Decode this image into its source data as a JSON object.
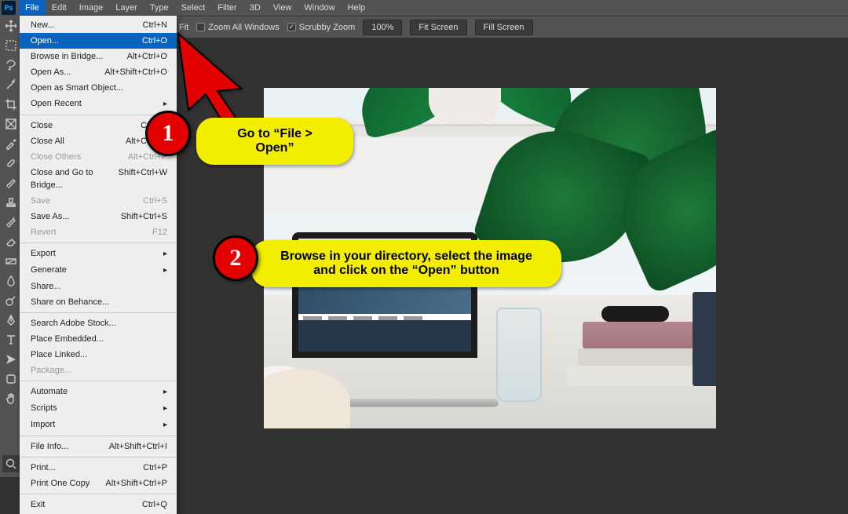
{
  "menubar": {
    "items": [
      "File",
      "Edit",
      "Image",
      "Layer",
      "Type",
      "Select",
      "Filter",
      "3D",
      "View",
      "Window",
      "Help"
    ],
    "active_index": 0
  },
  "optbar": {
    "fit_label": "Fit",
    "zoom_all_label": "Zoom All Windows",
    "scrubby_label": "Scrubby Zoom",
    "scrubby_checked": "✓",
    "zoom_value": "100%",
    "fit_screen": "Fit Screen",
    "fill_screen": "Fill Screen"
  },
  "file_menu": [
    {
      "label": "New...",
      "shortcut": "Ctrl+N"
    },
    {
      "label": "Open...",
      "shortcut": "Ctrl+O",
      "highlight": true
    },
    {
      "label": "Browse in Bridge...",
      "shortcut": "Alt+Ctrl+O"
    },
    {
      "label": "Open As...",
      "shortcut": "Alt+Shift+Ctrl+O"
    },
    {
      "label": "Open as Smart Object..."
    },
    {
      "label": "Open Recent",
      "sub": true
    },
    {
      "sep": true
    },
    {
      "label": "Close",
      "shortcut": "Ctrl+W"
    },
    {
      "label": "Close All",
      "shortcut": "Alt+Ctrl+W"
    },
    {
      "label": "Close Others",
      "shortcut": "Alt+Ctrl+P",
      "disabled": true
    },
    {
      "label": "Close and Go to Bridge...",
      "shortcut": "Shift+Ctrl+W"
    },
    {
      "label": "Save",
      "shortcut": "Ctrl+S",
      "disabled": true
    },
    {
      "label": "Save As...",
      "shortcut": "Shift+Ctrl+S"
    },
    {
      "label": "Revert",
      "shortcut": "F12",
      "disabled": true
    },
    {
      "sep": true
    },
    {
      "label": "Export",
      "sub": true
    },
    {
      "label": "Generate",
      "sub": true
    },
    {
      "label": "Share..."
    },
    {
      "label": "Share on Behance..."
    },
    {
      "sep": true
    },
    {
      "label": "Search Adobe Stock..."
    },
    {
      "label": "Place Embedded..."
    },
    {
      "label": "Place Linked..."
    },
    {
      "label": "Package...",
      "disabled": true
    },
    {
      "sep": true
    },
    {
      "label": "Automate",
      "sub": true
    },
    {
      "label": "Scripts",
      "sub": true
    },
    {
      "label": "Import",
      "sub": true
    },
    {
      "sep": true
    },
    {
      "label": "File Info...",
      "shortcut": "Alt+Shift+Ctrl+I"
    },
    {
      "sep": true
    },
    {
      "label": "Print...",
      "shortcut": "Ctrl+P"
    },
    {
      "label": "Print One Copy",
      "shortcut": "Alt+Shift+Ctrl+P"
    },
    {
      "sep": true
    },
    {
      "label": "Exit",
      "shortcut": "Ctrl+Q"
    }
  ],
  "tools": [
    "move",
    "marquee",
    "lasso",
    "wand",
    "crop",
    "frame",
    "eyedrop",
    "heal",
    "brush",
    "stamp",
    "history",
    "eraser",
    "gradient",
    "blur",
    "dodge",
    "pen",
    "type",
    "path",
    "rect",
    "hand"
  ],
  "annotations": {
    "step1_num": "1",
    "step1_text": "Go to “File > Open”",
    "step2_num": "2",
    "step2_text": "Browse in your directory, select the image and click on the “Open” button"
  }
}
